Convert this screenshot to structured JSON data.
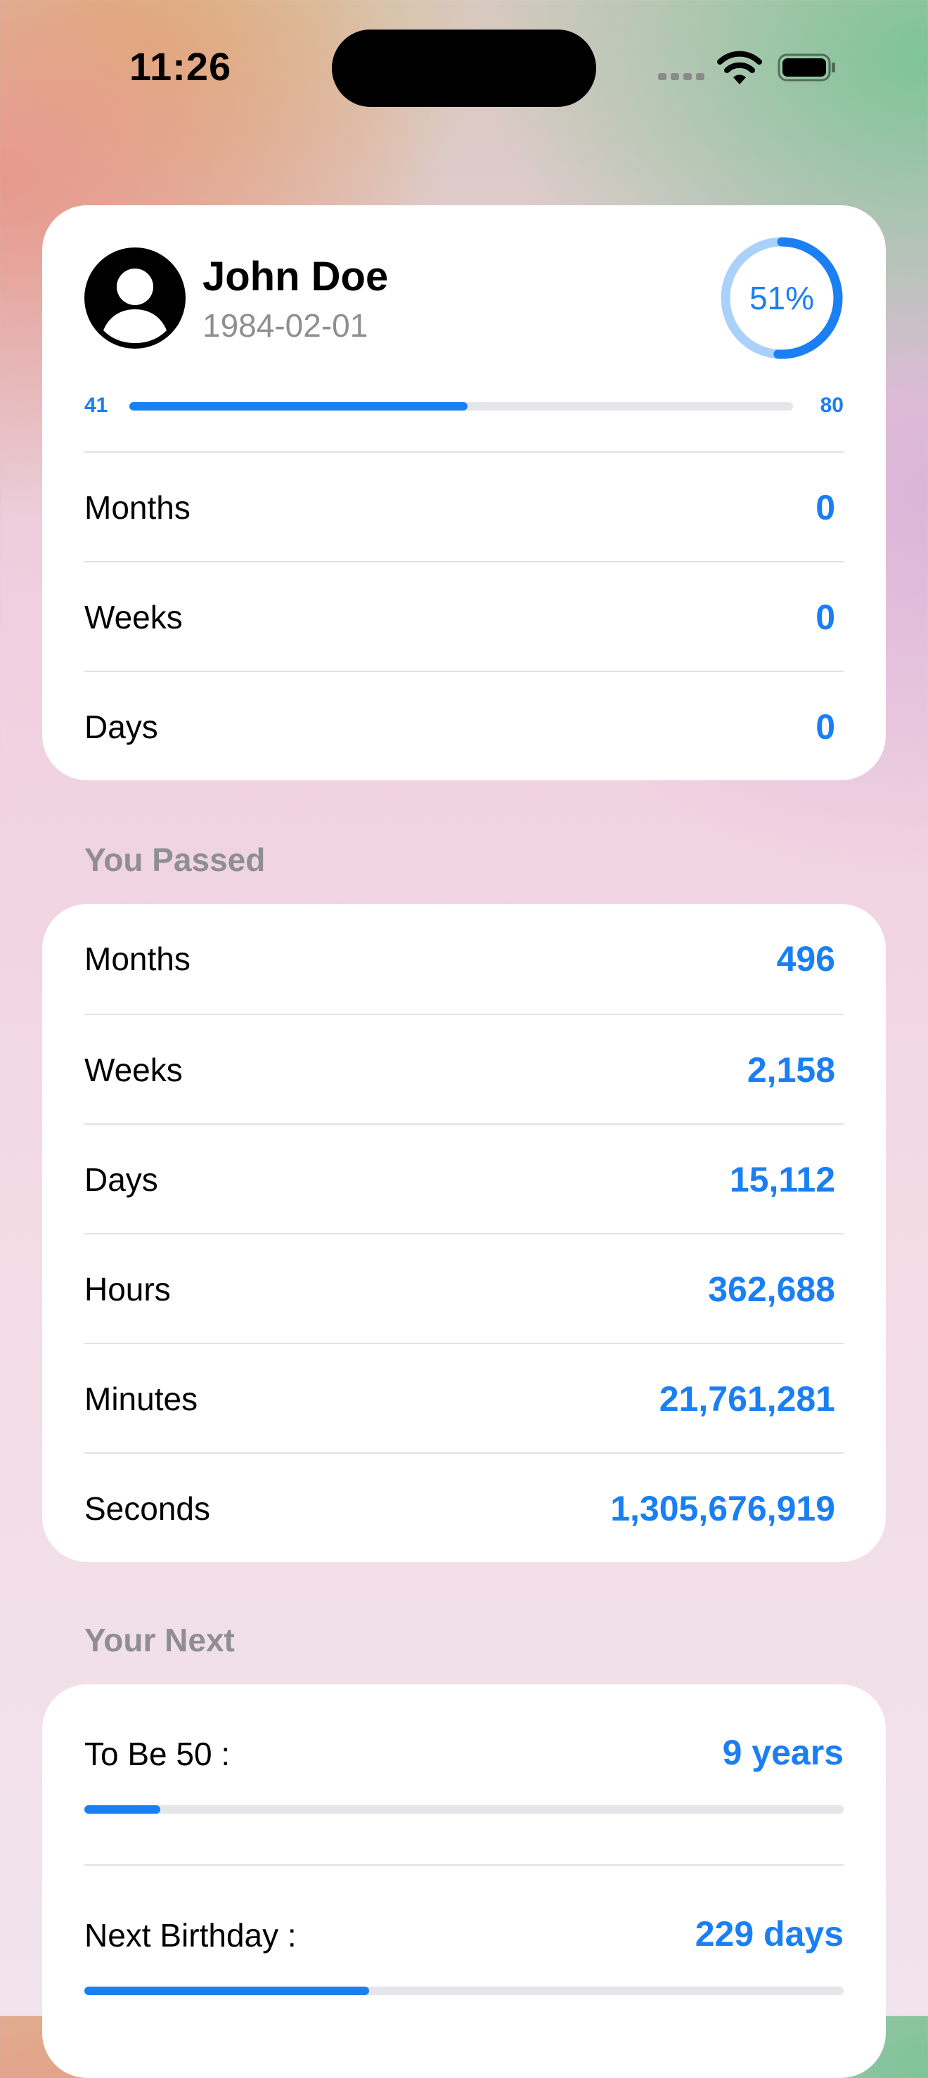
{
  "status_bar": {
    "time": "11:26"
  },
  "profile": {
    "name": "John Doe",
    "birth_date": "1984-02-01",
    "life_percent_label": "51%",
    "life_percent": 0.51,
    "current_age": "41",
    "life_expectancy": "80",
    "age_progress": 0.51,
    "remaining": [
      {
        "label": "Months",
        "value": "0"
      },
      {
        "label": "Weeks",
        "value": "0"
      },
      {
        "label": "Days",
        "value": "0"
      }
    ]
  },
  "passed": {
    "title": "You Passed",
    "rows": [
      {
        "label": "Months",
        "value": "496"
      },
      {
        "label": "Weeks",
        "value": "2,158"
      },
      {
        "label": "Days",
        "value": "15,112"
      },
      {
        "label": "Hours",
        "value": "362,688"
      },
      {
        "label": "Minutes",
        "value": "21,761,281"
      },
      {
        "label": "Seconds",
        "value": "1,305,676,919"
      }
    ]
  },
  "next": {
    "title": "Your Next",
    "items": [
      {
        "label": "To Be 50 :",
        "value": "9 years",
        "progress": 0.1
      },
      {
        "label": "Next Birthday :",
        "value": "229 days",
        "progress": 0.375
      }
    ]
  },
  "colors": {
    "accent": "#1a7ff2",
    "ring_track": "#a9d1fb",
    "secondary_text": "#8e8e93"
  }
}
